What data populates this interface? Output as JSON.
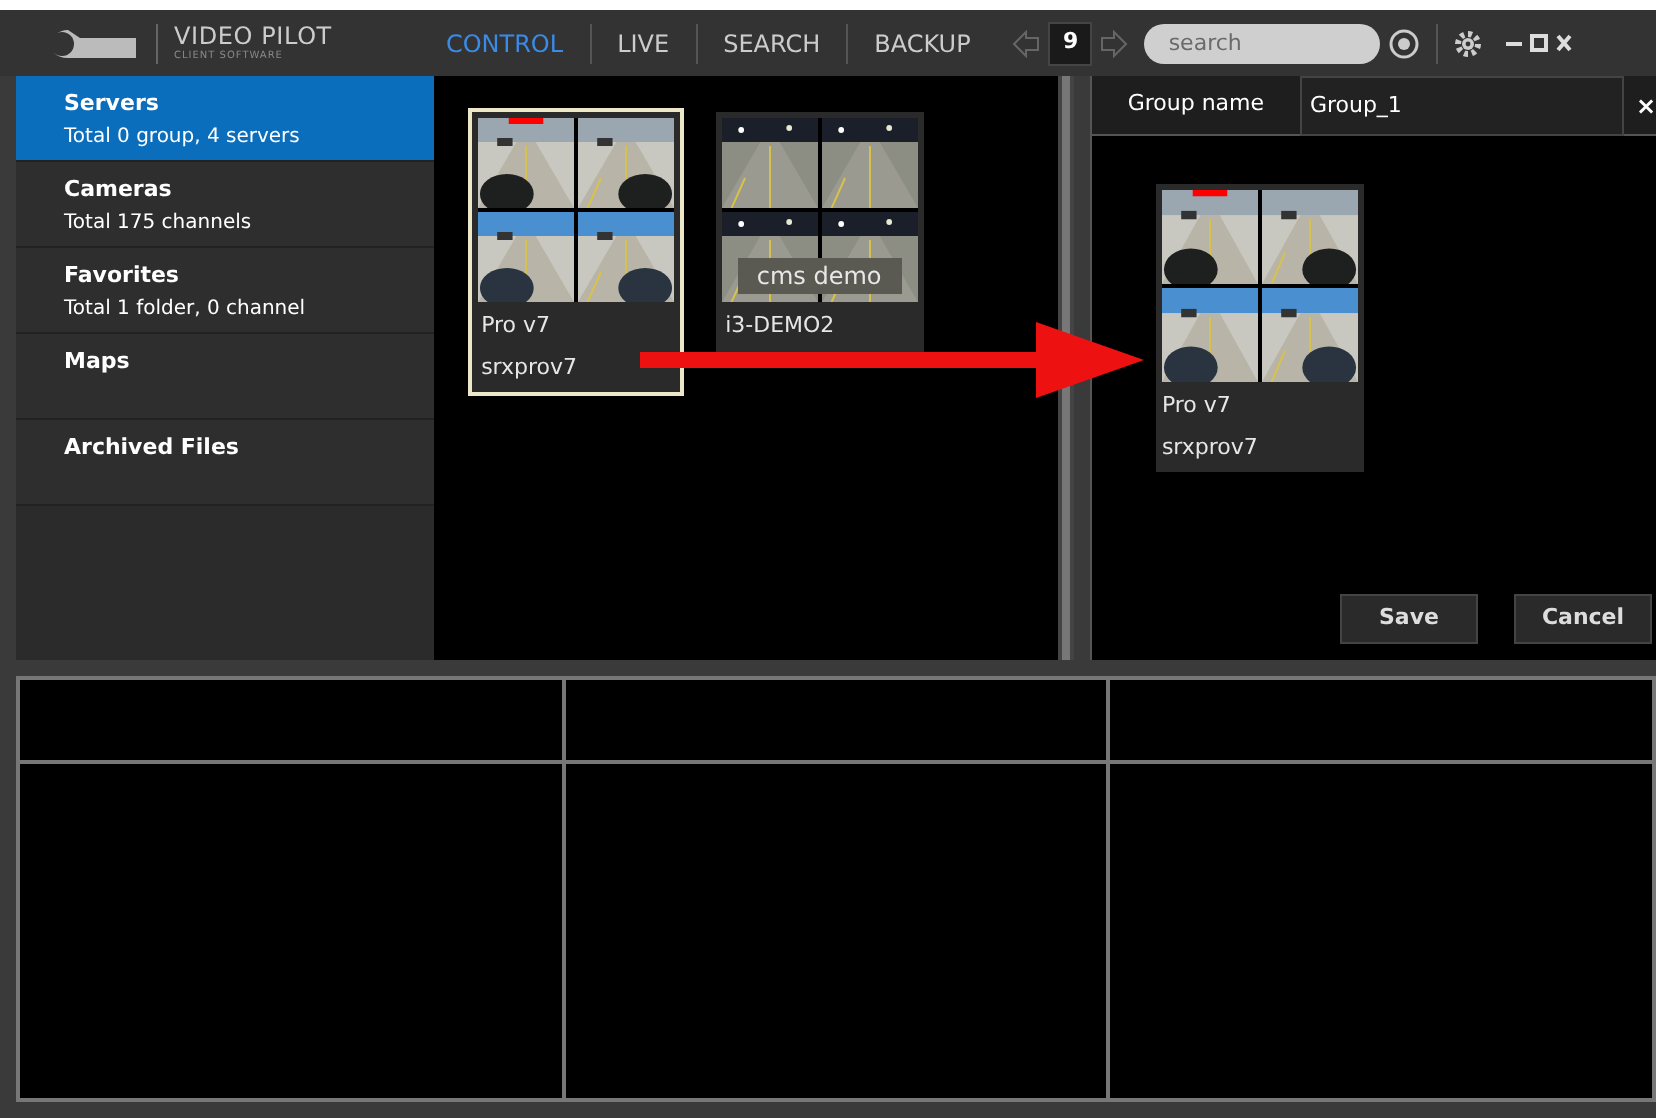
{
  "brand": {
    "title": "VIDEO PILOT",
    "subtitle": "CLIENT SOFTWARE"
  },
  "nav": [
    {
      "label": "CONTROL",
      "selected": true
    },
    {
      "label": "LIVE",
      "selected": false
    },
    {
      "label": "SEARCH",
      "selected": false
    },
    {
      "label": "BACKUP",
      "selected": false
    }
  ],
  "layout_count": "9",
  "search": {
    "placeholder": "search"
  },
  "sidebar": {
    "items": [
      {
        "title": "Servers",
        "subtitle": "Total 0 group, 4 servers",
        "selected": true
      },
      {
        "title": "Cameras",
        "subtitle": "Total 175 channels",
        "selected": false
      },
      {
        "title": "Favorites",
        "subtitle": "Total 1 folder, 0 channel",
        "selected": false
      },
      {
        "title": "Maps",
        "selected": false
      },
      {
        "title": "Archived Files",
        "selected": false
      }
    ]
  },
  "servers": [
    {
      "name": "Pro v7",
      "host": "srxprov7",
      "selected": true
    },
    {
      "name": "i3-DEMO2",
      "overlay": "cms demo",
      "selected": false
    }
  ],
  "group_panel": {
    "label": "Group name",
    "value": "Group_1",
    "close": "×",
    "members": [
      {
        "name": "Pro v7",
        "host": "srxprov7"
      }
    ],
    "buttons": [
      "Save",
      "Cancel"
    ]
  }
}
